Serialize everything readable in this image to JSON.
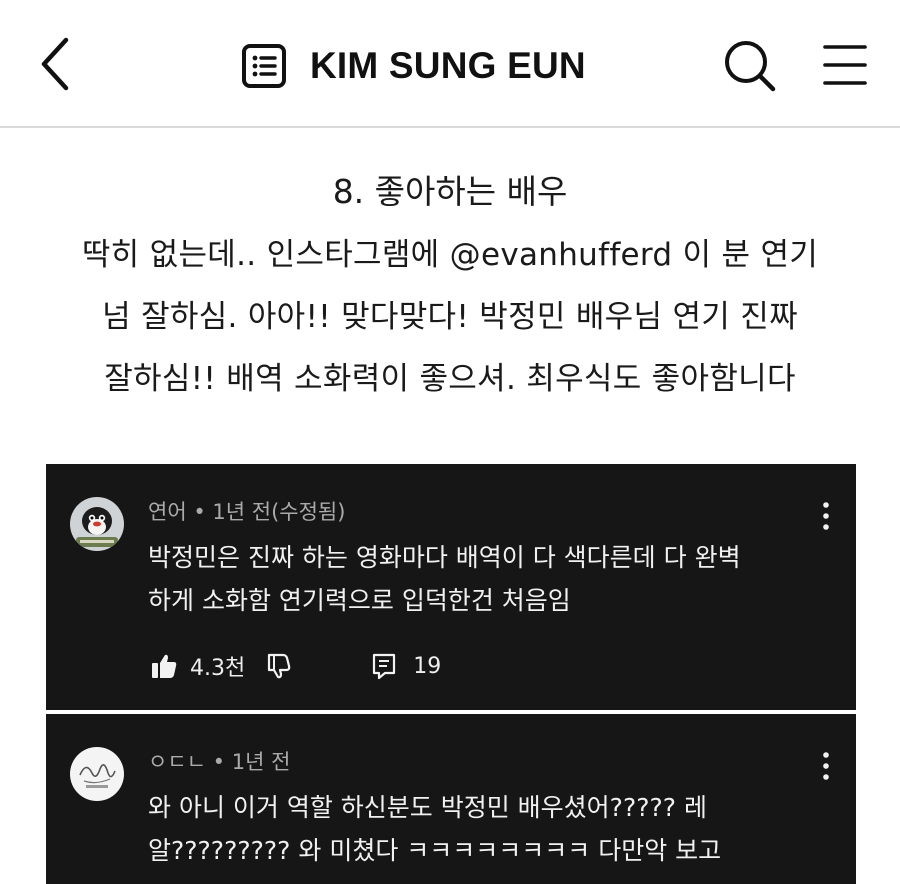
{
  "header": {
    "title": "KIM SUNG EUN",
    "back_icon": "chevron-left-icon",
    "post_list_icon": "list-document-icon",
    "search_icon": "search-icon",
    "menu_icon": "hamburger-menu-icon"
  },
  "post": {
    "heading": "8. 좋아하는 배우",
    "lines": [
      "딱히 없는데.. 인스타그램에 @evanhufferd 이 분 연기",
      "넘 잘하심. 아아!! 맞다맞다! 박정민 배우님 연기 진짜",
      "잘하심!! 배역 소화력이 좋으셔. 최우식도 좋아함니다"
    ]
  },
  "comments": [
    {
      "author": "연어",
      "time": "1년 전(수정됨)",
      "text_lines": [
        "박정민은 진짜 하는 영화마다 배역이 다 색다른데 다 완벽",
        "하게 소화함 연기력으로 입덕한건 처음임"
      ],
      "likes": "4.3천",
      "replies": "19"
    },
    {
      "author": "ㅇㄷㄴ",
      "time": "1년 전",
      "text_lines": [
        "와 아니 이거 역할 하신분도 박정민 배우셨어????? 레",
        "알????????? 와 미쳤다 ㅋㅋㅋㅋㅋㅋㅋㅋ 다만악 보고"
      ]
    }
  ],
  "colors": {
    "card_background": "#161616",
    "meta_text": "#aaaaaa",
    "header_divider": "#d9d9d9"
  }
}
